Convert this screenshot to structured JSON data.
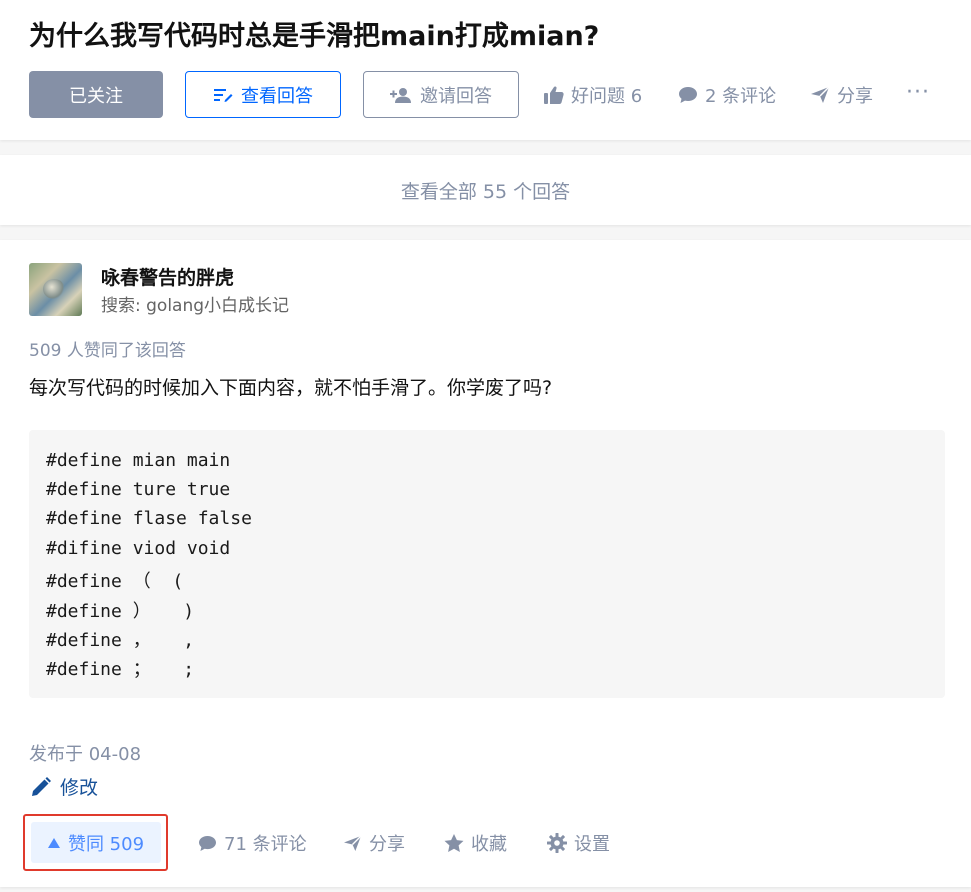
{
  "question": {
    "title": "为什么我写代码时总是手滑把main打成mian?",
    "follow_label": "已关注",
    "view_answer_label": "查看回答",
    "invite_label": "邀请回答",
    "good_question_label": "好问题 6",
    "comments_label": "2 条评论",
    "share_label": "分享",
    "more_label": "···"
  },
  "all_answers_label": "查看全部 55 个回答",
  "answer": {
    "author_name": "咏春警告的胖虎",
    "author_bio": "搜索: golang小白成长记",
    "vote_summary": "509 人赞同了该回答",
    "text": "每次写代码的时候加入下面内容，就不怕手滑了。你学废了吗?",
    "code_lines": [
      "#define mian main",
      "#define ture true",
      "#define flase false",
      "#difine viod void",
      "#define （  (",
      "#define ）   )",
      "#define ，   ,",
      "#define ；   ;"
    ],
    "publish_time": "发布于 04-08",
    "edit_label": "修改",
    "vote_label": "赞同 509",
    "comments_label": "71 条评论",
    "share_label": "分享",
    "collect_label": "收藏",
    "settings_label": "设置"
  },
  "colors": {
    "brand_blue": "#0066ff",
    "muted_gray": "#8590a6",
    "highlight_red": "#e03a2c",
    "link_blue": "#175199"
  }
}
